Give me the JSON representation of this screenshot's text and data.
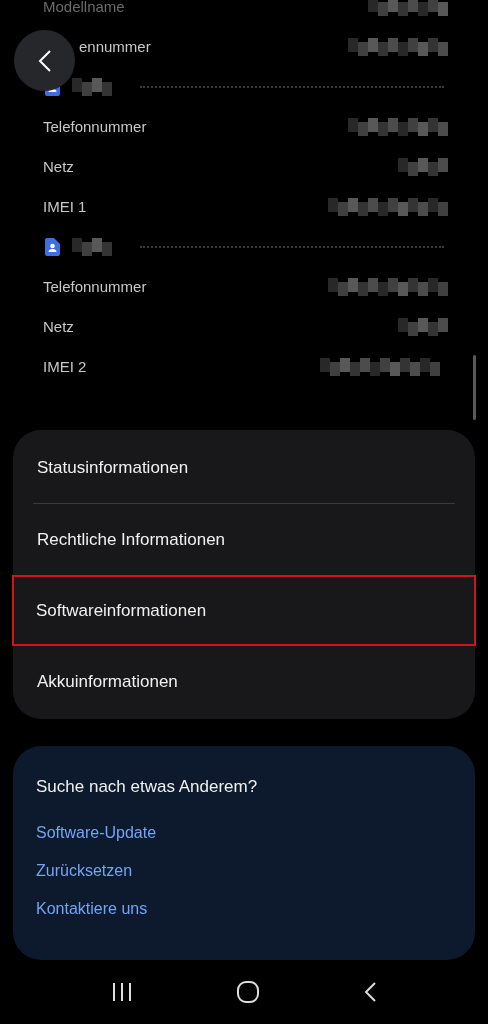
{
  "info_rows": [
    {
      "kind": "row",
      "label": "Modellname"
    },
    {
      "kind": "row",
      "label": "ennummer"
    },
    {
      "kind": "sim_header"
    },
    {
      "kind": "row",
      "label": "Telefonnummer"
    },
    {
      "kind": "row",
      "label": "Netz"
    },
    {
      "kind": "row",
      "label": "IMEI 1"
    },
    {
      "kind": "sim_header"
    },
    {
      "kind": "row",
      "label": "Telefonnummer"
    },
    {
      "kind": "row",
      "label": "Netz"
    },
    {
      "kind": "row",
      "label": "IMEI 2"
    }
  ],
  "menu": [
    {
      "label": "Statusinformationen",
      "highlighted": false
    },
    {
      "label": "Rechtliche Informationen",
      "highlighted": false
    },
    {
      "label": "Softwareinformationen",
      "highlighted": true
    },
    {
      "label": "Akkuinformationen",
      "highlighted": false
    }
  ],
  "suggestions": {
    "title": "Suche nach etwas Anderem?",
    "links": [
      "Software-Update",
      "Zurücksetzen",
      "Kontaktiere uns"
    ]
  }
}
